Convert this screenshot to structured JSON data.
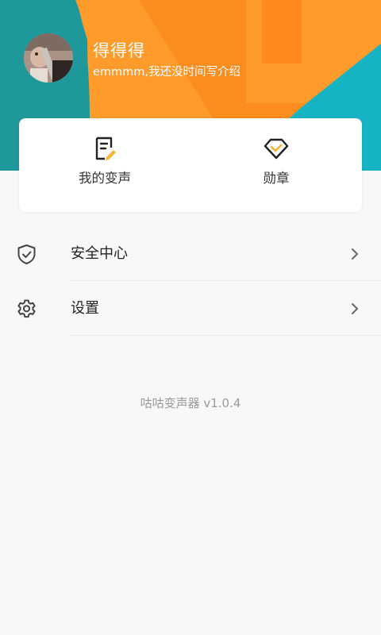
{
  "profile": {
    "username": "得得得",
    "bio": "emmmm,我还没时间写介绍"
  },
  "quick_actions": [
    {
      "label": "我的变声",
      "icon": "voice-note-edit-icon"
    },
    {
      "label": "勋章",
      "icon": "medal-diamond-icon"
    }
  ],
  "menu": [
    {
      "label": "安全中心",
      "icon": "shield-check-icon"
    },
    {
      "label": "设置",
      "icon": "gear-icon"
    }
  ],
  "footer": {
    "version": "咕咕变声器 v1.0.4"
  },
  "colors": {
    "header_orange": "#ff8a1f",
    "header_teal": "#1ab3c6",
    "accent_yellow": "#f4b731",
    "background": "#f8f8f8"
  }
}
